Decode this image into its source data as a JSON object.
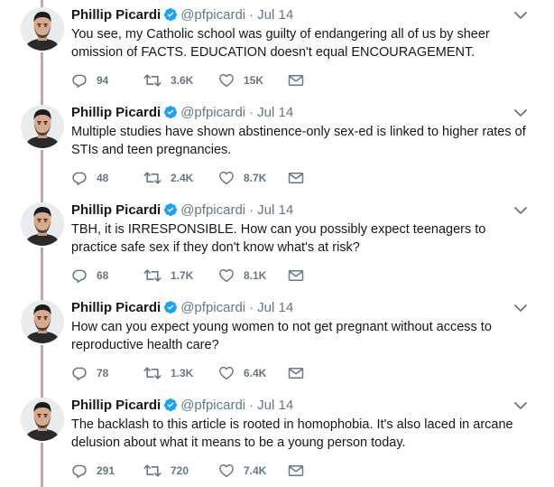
{
  "tweets": [
    {
      "author_name": "Phillip Picardi",
      "handle": "@pfpicardi",
      "separator": "·",
      "date": "Jul 14",
      "text": "You see, my Catholic school was guilty of endangering all of us by sheer omission of FACTS. EDUCATION doesn't equal ENCOURAGEMENT.",
      "replies": "94",
      "retweets": "3.6K",
      "likes": "15K"
    },
    {
      "author_name": "Phillip Picardi",
      "handle": "@pfpicardi",
      "separator": "·",
      "date": "Jul 14",
      "text": "Multiple studies have shown abstinence-only sex-ed is linked to higher rates of STIs and teen pregnancies.",
      "replies": "48",
      "retweets": "2.4K",
      "likes": "8.7K"
    },
    {
      "author_name": "Phillip Picardi",
      "handle": "@pfpicardi",
      "separator": "·",
      "date": "Jul 14",
      "text": "TBH, it is IRRESPONSIBLE. How can you possibly expect teenagers to practice safe sex if they don't know what's at risk?",
      "replies": "68",
      "retweets": "1.7K",
      "likes": "8.1K"
    },
    {
      "author_name": "Phillip Picardi",
      "handle": "@pfpicardi",
      "separator": "·",
      "date": "Jul 14",
      "text": "How can you expect young women to not get pregnant without access to reproductive health care?",
      "replies": "78",
      "retweets": "1.3K",
      "likes": "6.4K"
    },
    {
      "author_name": "Phillip Picardi",
      "handle": "@pfpicardi",
      "separator": "·",
      "date": "Jul 14",
      "text": "The backlash to this article is rooted in homophobia. It's also laced in arcane delusion about what it means to be a young person today.",
      "replies": "291",
      "retweets": "720",
      "likes": "7.4K"
    }
  ],
  "colors": {
    "thread_line": "#c7a4ad",
    "verified": "#1da1f2",
    "muted": "#657786",
    "text": "#14171a"
  },
  "icons": {
    "reply": "reply-icon",
    "retweet": "retweet-icon",
    "like": "heart-icon",
    "message": "envelope-icon",
    "caret": "chevron-down-icon",
    "verified": "verified-badge-icon"
  }
}
